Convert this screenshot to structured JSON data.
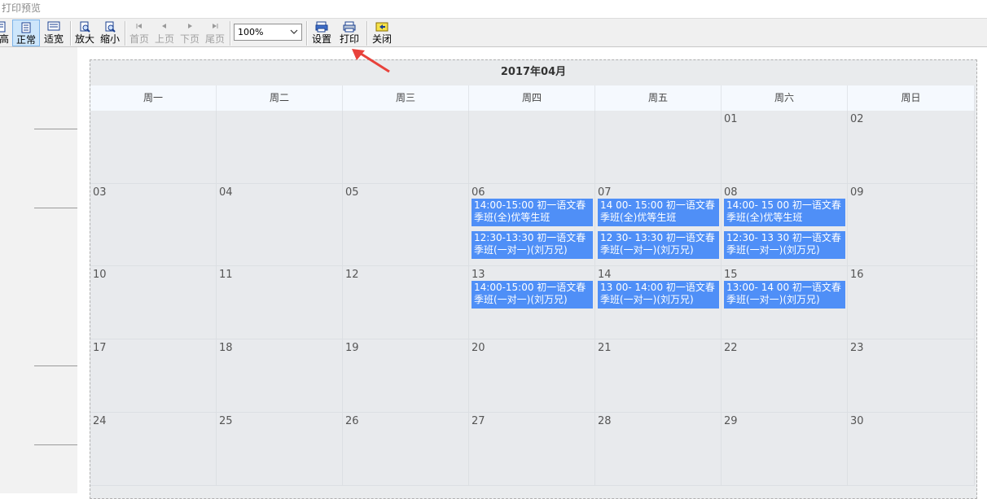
{
  "window": {
    "title": "打印预览"
  },
  "toolbar": {
    "buttons": [
      {
        "label": "高",
        "icon": "page-height-icon"
      },
      {
        "label": "正常",
        "icon": "page-normal-icon"
      },
      {
        "label": "适宽",
        "icon": "page-width-icon"
      },
      {
        "label": "放大",
        "icon": "zoom-in-icon"
      },
      {
        "label": "缩小",
        "icon": "zoom-out-icon"
      },
      {
        "label": "首页",
        "icon": "first-page-icon"
      },
      {
        "label": "上页",
        "icon": "prev-page-icon"
      },
      {
        "label": "下页",
        "icon": "next-page-icon"
      },
      {
        "label": "尾页",
        "icon": "last-page-icon"
      },
      {
        "label": "设置",
        "icon": "settings-icon"
      },
      {
        "label": "打印",
        "icon": "printer-icon"
      },
      {
        "label": "关闭",
        "icon": "close-icon"
      }
    ],
    "zoom_value": "100%"
  },
  "calendar": {
    "title": "2017年04月",
    "weekdays": [
      "周一",
      "周二",
      "周三",
      "周四",
      "周五",
      "周六",
      "周日"
    ],
    "weeks": [
      [
        "",
        "",
        "",
        "",
        "",
        "01",
        "02"
      ],
      [
        "03",
        "04",
        "05",
        "06",
        "07",
        "08",
        "09"
      ],
      [
        "10",
        "11",
        "12",
        "13",
        "14",
        "15",
        "16"
      ],
      [
        "17",
        "18",
        "19",
        "20",
        "21",
        "22",
        "23"
      ],
      [
        "24",
        "25",
        "26",
        "27",
        "28",
        "29",
        "30"
      ]
    ],
    "events": {
      "e1": "14:00-15:00 初一语文春季班(全)优等生班",
      "e2": "12:30-13:30 初一语文春季班(一对一)(刘万兄)",
      "e3": "14 00- 15:00 初一语文春季班(全)优等生班",
      "e4": "12 30- 13:30 初一语文春季班(一对一)(刘万兄)",
      "e5": "14:00- 15 00 初一语文春季班(全)优等生班",
      "e6": "12:30- 13 30 初一语文春季班(一对一)(刘万兄)",
      "e7": "14:00-15:00 初一语文春季班(一对一)(刘万兄)",
      "e8": "13 00- 14:00 初一语文春季班(一对一)(刘万兄)",
      "e9": "13:00- 14 00 初一语文春季班(一对一)(刘万兄)"
    }
  },
  "colors": {
    "event_bg": "#4f8ff7",
    "arrow": "#e8423b",
    "active_button": "#cde6fb"
  }
}
